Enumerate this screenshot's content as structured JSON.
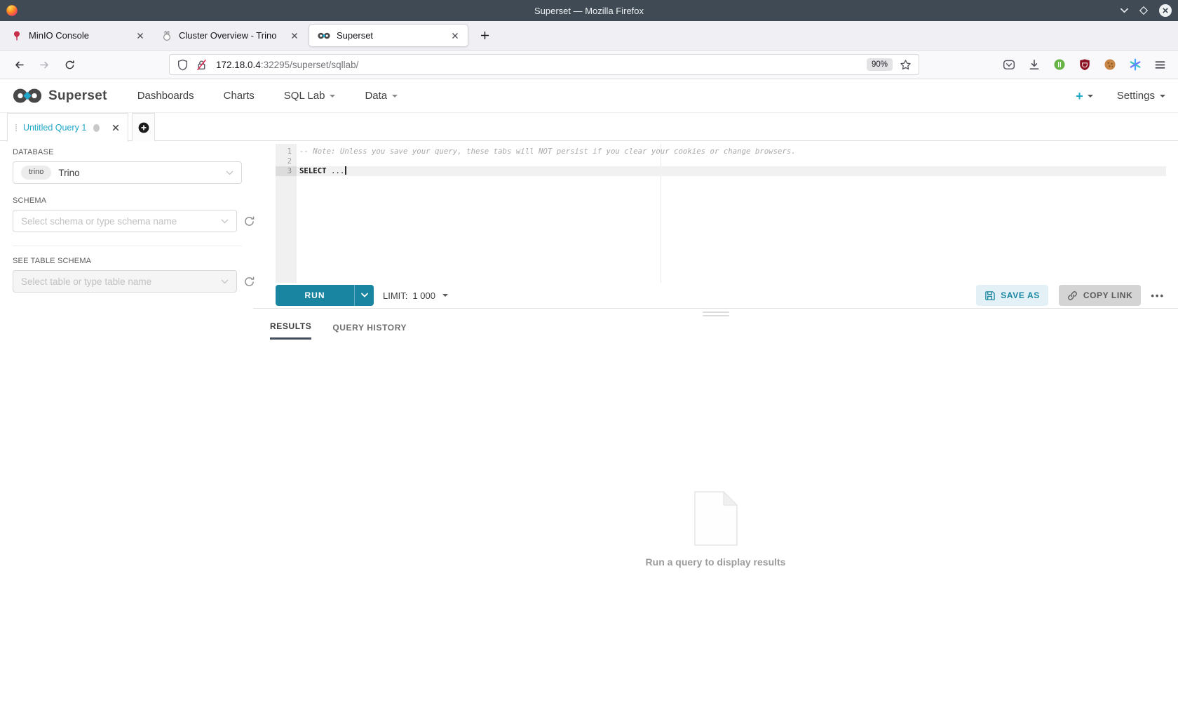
{
  "window": {
    "title": "Superset — Mozilla Firefox",
    "zoom_badge": "90%"
  },
  "browser": {
    "tabs": [
      {
        "title": "MinIO Console"
      },
      {
        "title": "Cluster Overview - Trino"
      },
      {
        "title": "Superset"
      }
    ],
    "url_host": "172.18.0.4",
    "url_path": ":32295/superset/sqllab/"
  },
  "navbar": {
    "brand": "Superset",
    "items": [
      "Dashboards",
      "Charts",
      "SQL Lab",
      "Data"
    ],
    "new_button": "+",
    "settings": "Settings"
  },
  "query_tabs": {
    "active_title": "Untitled Query 1"
  },
  "sidebar": {
    "database_label": "DATABASE",
    "database_badge": "trino",
    "database_value": "Trino",
    "schema_label": "SCHEMA",
    "schema_placeholder": "Select schema or type schema name",
    "table_label": "SEE TABLE SCHEMA",
    "table_placeholder": "Select table or type table name"
  },
  "editor": {
    "line_numbers": [
      "1",
      "2",
      "3"
    ],
    "comment": "-- Note: Unless you save your query, these tabs will NOT persist if you clear your cookies or change browsers.",
    "keyword": "SELECT",
    "code_rest": " ..."
  },
  "toolbar": {
    "run_label": "RUN",
    "limit_label": "LIMIT:",
    "limit_value": "1 000",
    "save_as_label": "SAVE AS",
    "copy_link_label": "COPY LINK",
    "more_label": "•••"
  },
  "results": {
    "tab_results": "RESULTS",
    "tab_history": "QUERY HISTORY",
    "empty_message": "Run a query to display results"
  },
  "colors": {
    "accent_teal": "#20A7C9",
    "run_button": "#1985A0",
    "titlebar": "#3F4A54"
  }
}
